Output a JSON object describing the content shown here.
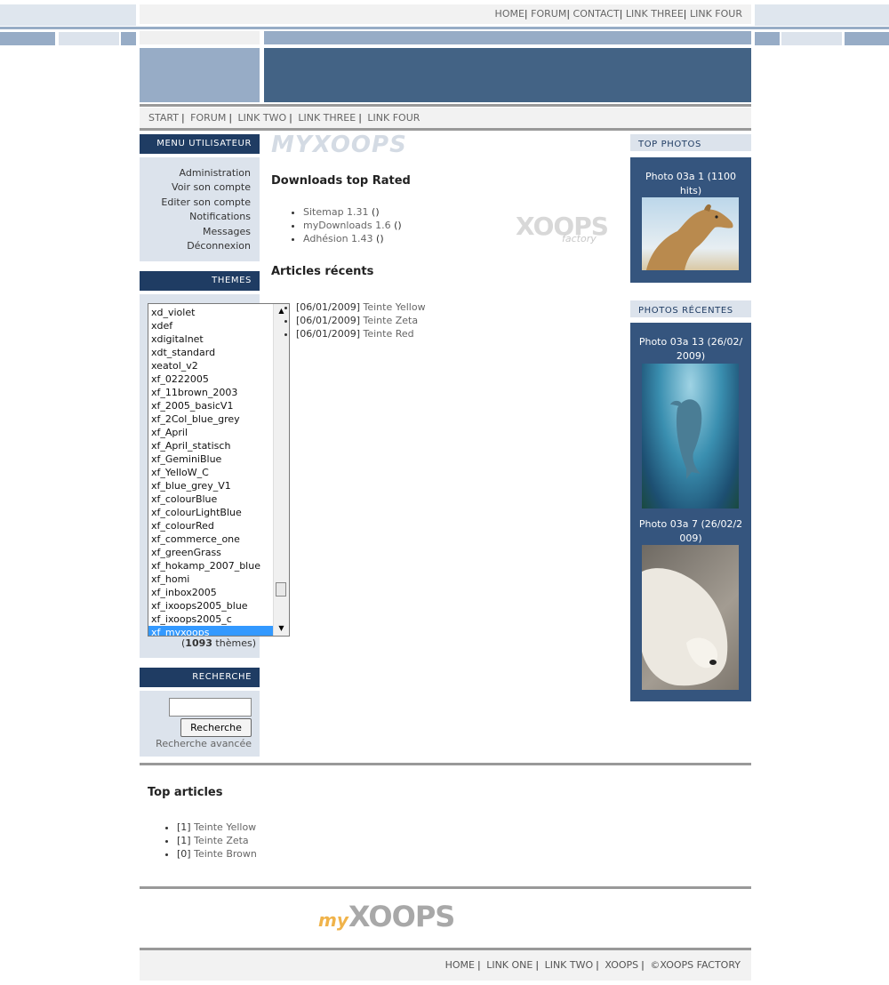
{
  "top_nav": [
    "HOME",
    "FORUM",
    "CONTACT",
    "LINK THREE",
    "LINK FOUR"
  ],
  "sec_nav": [
    "START",
    "FORUM",
    "LINK TWO",
    "LINK THREE",
    "LINK FOUR"
  ],
  "logo_text": "MYXOOPS",
  "user_menu": {
    "title": "MENU UTILISATEUR",
    "items": [
      "Administration",
      "Voir son compte",
      "Editer son compte",
      "Notifications",
      "Messages",
      "Déconnexion"
    ]
  },
  "themes": {
    "title": "THEMES",
    "options": [
      "xd_violet",
      "xdef",
      "xdigitalnet",
      "xdt_standard",
      "xeatol_v2",
      "xf_0222005",
      "xf_11brown_2003",
      "xf_2005_basicV1",
      "xf_2Col_blue_grey",
      "xf_April",
      "xf_April_statisch",
      "xf_GeminiBlue",
      "xf_YelloW_C",
      "xf_blue_grey_V1",
      "xf_colourBlue",
      "xf_colourLightBlue",
      "xf_colourRed",
      "xf_commerce_one",
      "xf_greenGrass",
      "xf_hokamp_2007_blue",
      "xf_homi",
      "xf_inbox2005",
      "xf_ixoops2005_blue",
      "xf_ixoops2005_c",
      "xf_myxoops"
    ],
    "selected": "xf_myxoops",
    "count": "1093",
    "count_suffix": "thèmes"
  },
  "search": {
    "title": "RECHERCHE",
    "input_value": "",
    "button_label": "Recherche",
    "advanced_link": "Recherche avancée"
  },
  "downloads": {
    "heading": "Downloads top Rated",
    "items": [
      {
        "name": "Sitemap 1.31",
        "suffix": "()"
      },
      {
        "name": "myDownloads 1.6",
        "suffix": "()"
      },
      {
        "name": "Adhésion 1.43",
        "suffix": "()"
      }
    ],
    "badge_text": "XOOPS",
    "badge_sub": "factory"
  },
  "recent_articles": {
    "heading": "Articles récents",
    "items": [
      {
        "date": "[06/01/2009]",
        "title": "Teinte Yellow"
      },
      {
        "date": "[06/01/2009]",
        "title": "Teinte Zeta"
      },
      {
        "date": "[06/01/2009]",
        "title": "Teinte Red"
      }
    ]
  },
  "top_photos": {
    "title": "TOP PHOTOS",
    "items": [
      {
        "caption": "Photo 03a 1 (1100 hits)",
        "image": "camel-photo"
      }
    ]
  },
  "recent_photos": {
    "title": "PHOTOS RÉCENTES",
    "items": [
      {
        "caption": "Photo 03a 13 (26/02/2009)",
        "image": "dolphin-photo"
      },
      {
        "caption": "Photo 03a 7 (26/02/2009)",
        "image": "polar-bear-photo"
      }
    ]
  },
  "top_articles": {
    "heading": "Top articles",
    "items": [
      {
        "rank": "[1]",
        "title": "Teinte Yellow"
      },
      {
        "rank": "[1]",
        "title": "Teinte Zeta"
      },
      {
        "rank": "[0]",
        "title": "Teinte Brown"
      }
    ]
  },
  "footer_logo": {
    "my": "my",
    "xoops": "XOOPS"
  },
  "footer_nav": [
    "HOME",
    "LINK ONE",
    "LINK TWO",
    "XOOPS",
    "©XOOPS FACTORY"
  ],
  "colors": {
    "dark_blue": "#1f3c63",
    "mid_blue": "#35557e",
    "header_blue": "#436385",
    "light_blue": "#dce3ec"
  }
}
